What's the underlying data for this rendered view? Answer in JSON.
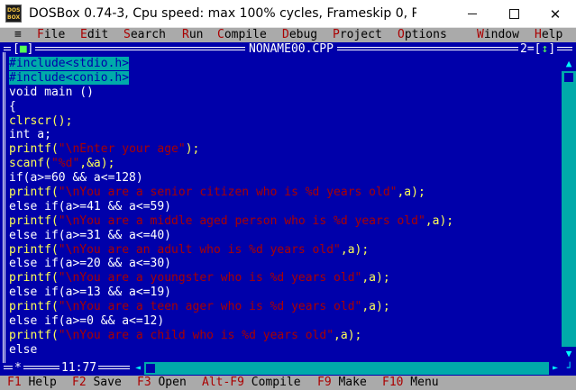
{
  "window": {
    "title": "DOSBox 0.74-3, Cpu speed: max 100% cycles, Frameskip  0, P...",
    "icon_top": "DOS",
    "icon_bottom": "BOX",
    "minimize": "minimize-icon",
    "maximize": "maximize-icon",
    "close_label": "✕"
  },
  "menu": {
    "system": "≡",
    "items": [
      {
        "hotkey": "F",
        "rest": "ile"
      },
      {
        "hotkey": "E",
        "rest": "dit"
      },
      {
        "hotkey": "S",
        "rest": "earch"
      },
      {
        "hotkey": "R",
        "rest": "un"
      },
      {
        "hotkey": "C",
        "rest": "ompile"
      },
      {
        "hotkey": "D",
        "rest": "ebug"
      },
      {
        "hotkey": "P",
        "rest": "roject"
      },
      {
        "hotkey": "O",
        "rest": "ptions"
      },
      {
        "hotkey": "W",
        "rest": "indow"
      },
      {
        "hotkey": "H",
        "rest": "elp"
      }
    ]
  },
  "editor": {
    "close_box_left": "[",
    "close_box_mark": "■",
    "close_box_right": "]",
    "filename": "NONAME00.CPP",
    "window_number": "2",
    "zoom_left": "=[",
    "zoom_mark": "↕",
    "zoom_right": "]",
    "cursor_position": "11:77",
    "modified_marker": "*",
    "code_lines": [
      [
        {
          "t": "#include<stdio.h>",
          "c": "hl"
        }
      ],
      [
        {
          "t": "#include<conio.h>",
          "c": "hl"
        }
      ],
      [
        {
          "t": "void main ()",
          "c": "w"
        }
      ],
      [
        {
          "t": "{",
          "c": "w"
        }
      ],
      [
        {
          "t": "clrscr();",
          "c": ""
        }
      ],
      [
        {
          "t": "int a;",
          "c": "w"
        }
      ],
      [
        {
          "t": "printf(",
          "c": ""
        },
        {
          "t": "\"\\nEnter your age\"",
          "c": "str"
        },
        {
          "t": ");",
          "c": ""
        }
      ],
      [
        {
          "t": "scanf(",
          "c": ""
        },
        {
          "t": "\"%d\"",
          "c": "str"
        },
        {
          "t": ",&a);",
          "c": ""
        }
      ],
      [
        {
          "t": "if(a>=60 && a<=128)",
          "c": "w"
        }
      ],
      [
        {
          "t": "printf(",
          "c": ""
        },
        {
          "t": "\"\\nYou are a senior citizen who is %d years old\"",
          "c": "str"
        },
        {
          "t": ",a);",
          "c": ""
        }
      ],
      [
        {
          "t": "else if(a>=41 && a<=59)",
          "c": "w"
        }
      ],
      [
        {
          "t": "printf(",
          "c": ""
        },
        {
          "t": "\"\\nYou are a middle aged person who is %d years old\"",
          "c": "str"
        },
        {
          "t": ",a);",
          "c": ""
        }
      ],
      [
        {
          "t": "else if(a>=31 && a<=40)",
          "c": "w"
        }
      ],
      [
        {
          "t": "printf(",
          "c": ""
        },
        {
          "t": "\"\\nYou are an adult who is %d years old\"",
          "c": "str"
        },
        {
          "t": ",a);",
          "c": ""
        }
      ],
      [
        {
          "t": "else if(a>=20 && a<=30)",
          "c": "w"
        }
      ],
      [
        {
          "t": "printf(",
          "c": ""
        },
        {
          "t": "\"\\nYou are a youngster who is %d years old\"",
          "c": "str"
        },
        {
          "t": ",a);",
          "c": ""
        }
      ],
      [
        {
          "t": "else if(a>=13 && a<=19)",
          "c": "w"
        }
      ],
      [
        {
          "t": "printf(",
          "c": ""
        },
        {
          "t": "\"\\nYou are a teen ager who is %d years old\"",
          "c": "str"
        },
        {
          "t": ",a);",
          "c": ""
        }
      ],
      [
        {
          "t": "else if(a>=0 && a<=12)",
          "c": "w"
        }
      ],
      [
        {
          "t": "printf(",
          "c": ""
        },
        {
          "t": "\"\\nYou are a child who is %d years old\"",
          "c": "str"
        },
        {
          "t": ",a);",
          "c": ""
        }
      ],
      [
        {
          "t": "else",
          "c": "w"
        }
      ]
    ]
  },
  "scroll": {
    "up": "▲",
    "down": "▼",
    "left": "◄",
    "right": "►",
    "corner": "┘"
  },
  "status": {
    "items": [
      {
        "key": "F1",
        "label": " Help"
      },
      {
        "key": "F2",
        "label": " Save"
      },
      {
        "key": "F3",
        "label": " Open"
      },
      {
        "key": "Alt-F9",
        "label": " Compile"
      },
      {
        "key": "F9",
        "label": " Make"
      },
      {
        "key": "F10",
        "label": " Menu"
      }
    ]
  },
  "colors": {
    "screen_bg": "#0000aa",
    "menu_bg": "#aaaaaa",
    "hotkey": "#aa0000",
    "code_default": "#ffff55",
    "string": "#aa0000",
    "highlight_bg": "#00aaaa"
  }
}
